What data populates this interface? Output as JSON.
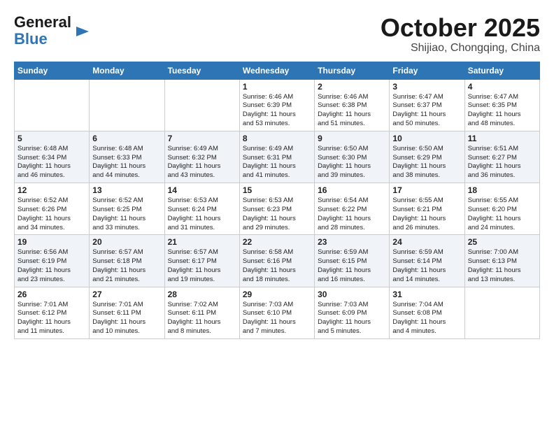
{
  "header": {
    "logo_line1": "General",
    "logo_line2": "Blue",
    "month_title": "October 2025",
    "location": "Shijiao, Chongqing, China"
  },
  "days_of_week": [
    "Sunday",
    "Monday",
    "Tuesday",
    "Wednesday",
    "Thursday",
    "Friday",
    "Saturday"
  ],
  "weeks": [
    [
      {
        "day": "",
        "info": ""
      },
      {
        "day": "",
        "info": ""
      },
      {
        "day": "",
        "info": ""
      },
      {
        "day": "1",
        "info": "Sunrise: 6:46 AM\nSunset: 6:39 PM\nDaylight: 11 hours\nand 53 minutes."
      },
      {
        "day": "2",
        "info": "Sunrise: 6:46 AM\nSunset: 6:38 PM\nDaylight: 11 hours\nand 51 minutes."
      },
      {
        "day": "3",
        "info": "Sunrise: 6:47 AM\nSunset: 6:37 PM\nDaylight: 11 hours\nand 50 minutes."
      },
      {
        "day": "4",
        "info": "Sunrise: 6:47 AM\nSunset: 6:35 PM\nDaylight: 11 hours\nand 48 minutes."
      }
    ],
    [
      {
        "day": "5",
        "info": "Sunrise: 6:48 AM\nSunset: 6:34 PM\nDaylight: 11 hours\nand 46 minutes."
      },
      {
        "day": "6",
        "info": "Sunrise: 6:48 AM\nSunset: 6:33 PM\nDaylight: 11 hours\nand 44 minutes."
      },
      {
        "day": "7",
        "info": "Sunrise: 6:49 AM\nSunset: 6:32 PM\nDaylight: 11 hours\nand 43 minutes."
      },
      {
        "day": "8",
        "info": "Sunrise: 6:49 AM\nSunset: 6:31 PM\nDaylight: 11 hours\nand 41 minutes."
      },
      {
        "day": "9",
        "info": "Sunrise: 6:50 AM\nSunset: 6:30 PM\nDaylight: 11 hours\nand 39 minutes."
      },
      {
        "day": "10",
        "info": "Sunrise: 6:50 AM\nSunset: 6:29 PM\nDaylight: 11 hours\nand 38 minutes."
      },
      {
        "day": "11",
        "info": "Sunrise: 6:51 AM\nSunset: 6:27 PM\nDaylight: 11 hours\nand 36 minutes."
      }
    ],
    [
      {
        "day": "12",
        "info": "Sunrise: 6:52 AM\nSunset: 6:26 PM\nDaylight: 11 hours\nand 34 minutes."
      },
      {
        "day": "13",
        "info": "Sunrise: 6:52 AM\nSunset: 6:25 PM\nDaylight: 11 hours\nand 33 minutes."
      },
      {
        "day": "14",
        "info": "Sunrise: 6:53 AM\nSunset: 6:24 PM\nDaylight: 11 hours\nand 31 minutes."
      },
      {
        "day": "15",
        "info": "Sunrise: 6:53 AM\nSunset: 6:23 PM\nDaylight: 11 hours\nand 29 minutes."
      },
      {
        "day": "16",
        "info": "Sunrise: 6:54 AM\nSunset: 6:22 PM\nDaylight: 11 hours\nand 28 minutes."
      },
      {
        "day": "17",
        "info": "Sunrise: 6:55 AM\nSunset: 6:21 PM\nDaylight: 11 hours\nand 26 minutes."
      },
      {
        "day": "18",
        "info": "Sunrise: 6:55 AM\nSunset: 6:20 PM\nDaylight: 11 hours\nand 24 minutes."
      }
    ],
    [
      {
        "day": "19",
        "info": "Sunrise: 6:56 AM\nSunset: 6:19 PM\nDaylight: 11 hours\nand 23 minutes."
      },
      {
        "day": "20",
        "info": "Sunrise: 6:57 AM\nSunset: 6:18 PM\nDaylight: 11 hours\nand 21 minutes."
      },
      {
        "day": "21",
        "info": "Sunrise: 6:57 AM\nSunset: 6:17 PM\nDaylight: 11 hours\nand 19 minutes."
      },
      {
        "day": "22",
        "info": "Sunrise: 6:58 AM\nSunset: 6:16 PM\nDaylight: 11 hours\nand 18 minutes."
      },
      {
        "day": "23",
        "info": "Sunrise: 6:59 AM\nSunset: 6:15 PM\nDaylight: 11 hours\nand 16 minutes."
      },
      {
        "day": "24",
        "info": "Sunrise: 6:59 AM\nSunset: 6:14 PM\nDaylight: 11 hours\nand 14 minutes."
      },
      {
        "day": "25",
        "info": "Sunrise: 7:00 AM\nSunset: 6:13 PM\nDaylight: 11 hours\nand 13 minutes."
      }
    ],
    [
      {
        "day": "26",
        "info": "Sunrise: 7:01 AM\nSunset: 6:12 PM\nDaylight: 11 hours\nand 11 minutes."
      },
      {
        "day": "27",
        "info": "Sunrise: 7:01 AM\nSunset: 6:11 PM\nDaylight: 11 hours\nand 10 minutes."
      },
      {
        "day": "28",
        "info": "Sunrise: 7:02 AM\nSunset: 6:11 PM\nDaylight: 11 hours\nand 8 minutes."
      },
      {
        "day": "29",
        "info": "Sunrise: 7:03 AM\nSunset: 6:10 PM\nDaylight: 11 hours\nand 7 minutes."
      },
      {
        "day": "30",
        "info": "Sunrise: 7:03 AM\nSunset: 6:09 PM\nDaylight: 11 hours\nand 5 minutes."
      },
      {
        "day": "31",
        "info": "Sunrise: 7:04 AM\nSunset: 6:08 PM\nDaylight: 11 hours\nand 4 minutes."
      },
      {
        "day": "",
        "info": ""
      }
    ]
  ]
}
